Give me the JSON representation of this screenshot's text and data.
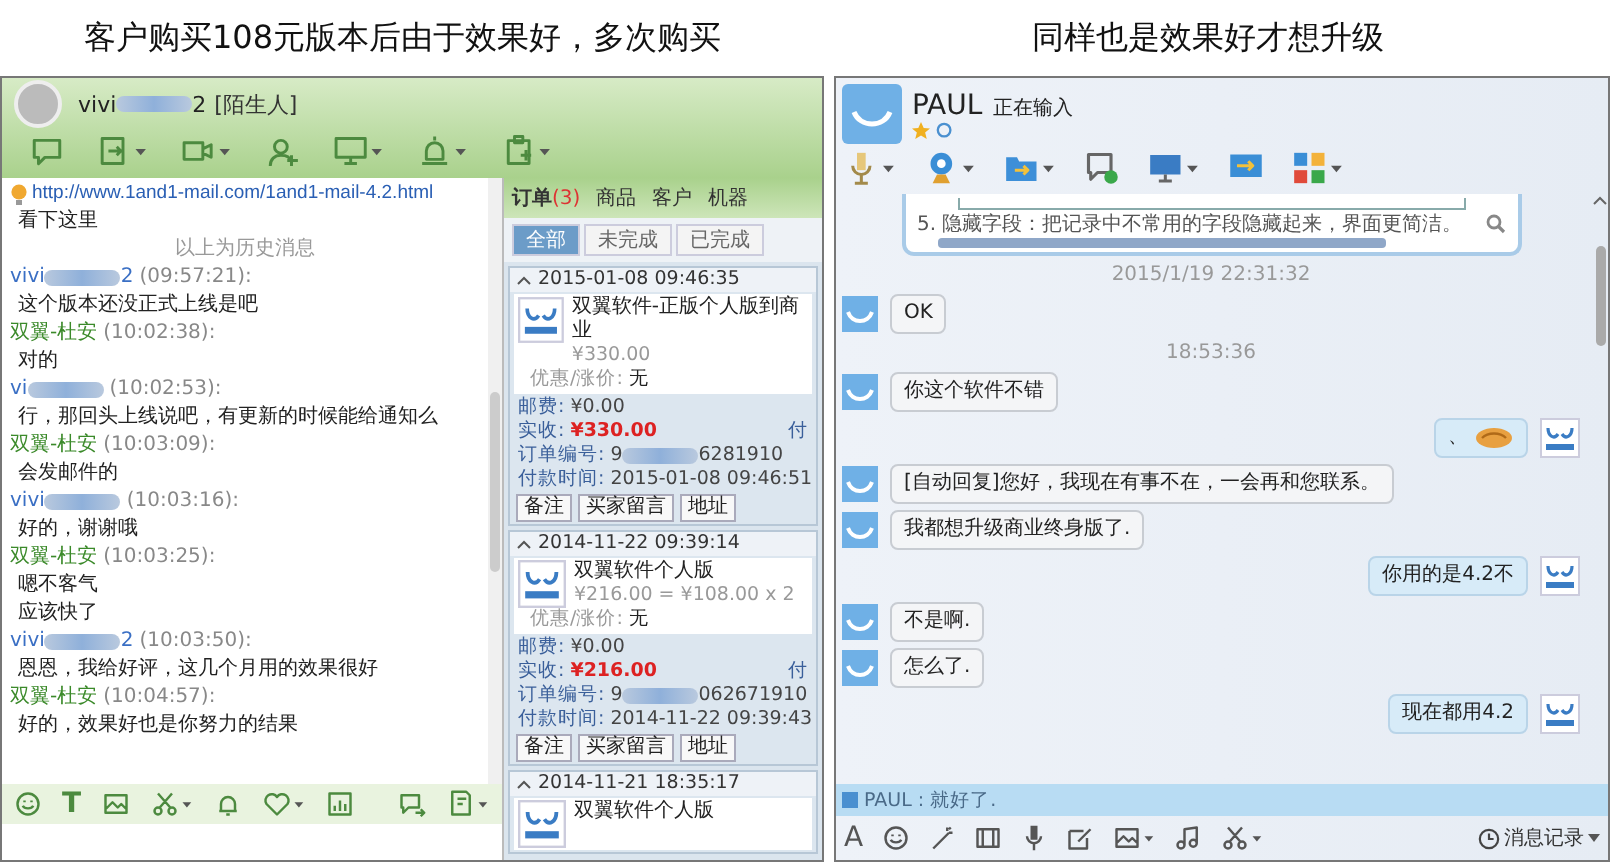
{
  "captions": [
    "客户购买108元版本后由于效果好，多次购买",
    "同样也是效果好才想升级"
  ],
  "left_window": {
    "contact": {
      "name_prefix": "vivi",
      "name_suffix": "2",
      "tag": "[陌生人]"
    },
    "link": "http://www.1and1-mail.com/1and1-mail-4.2.html",
    "link_note": "看下这里",
    "history_divider": "以上为历史消息",
    "messages": [
      {
        "kind": "customer",
        "name_prefix": "vivi",
        "name_suffix": "2",
        "time": "(09:57:21):",
        "lines": [
          "这个版本还没正式上线是吧"
        ]
      },
      {
        "kind": "agent",
        "name": "双翼-杜安",
        "time": "(10:02:38):",
        "lines": [
          "对的"
        ]
      },
      {
        "kind": "customer",
        "name_prefix": "vi",
        "time": "(10:02:53):",
        "lines": [
          "行，那回头上线说吧，有更新的时候能给通知么"
        ]
      },
      {
        "kind": "agent",
        "name": "双翼-杜安",
        "time": "(10:03:09):",
        "lines": [
          "会发邮件的"
        ]
      },
      {
        "kind": "customer",
        "name_prefix": "vivi",
        "time": "(10:03:16):",
        "lines": [
          "好的，谢谢哦"
        ]
      },
      {
        "kind": "agent",
        "name": "双翼-杜安",
        "time": "(10:03:25):",
        "lines": [
          "嗯不客气",
          "应该快了"
        ]
      },
      {
        "kind": "customer",
        "name_prefix": "vivi",
        "name_suffix": "2",
        "time": "(10:03:50):",
        "lines": [
          "恩恩，我给好评，这几个月用的效果很好"
        ]
      },
      {
        "kind": "agent",
        "name": "双翼-杜安",
        "time": "(10:04:57):",
        "lines": [
          "好的，效果好也是你努力的结果"
        ]
      }
    ],
    "font_button": "T",
    "tabs": [
      {
        "label": "订单",
        "badge": "(3)",
        "selected": true
      },
      {
        "label": "商品",
        "selected": false
      },
      {
        "label": "客户",
        "selected": false
      },
      {
        "label": "机器",
        "selected": false
      }
    ],
    "order_filters": [
      {
        "label": "全部",
        "selected": true
      },
      {
        "label": "未完成",
        "selected": false
      },
      {
        "label": "已完成",
        "selected": false
      }
    ],
    "orders": [
      {
        "expanded": true,
        "date": "2015-01-08 09:46:35",
        "product": "双翼软件-正版个人版到商业",
        "price": "¥330.00",
        "discount_label": "优惠/涨价:",
        "discount": "无",
        "fields": [
          {
            "kind": "plain",
            "label": "邮费:",
            "value": "¥0.00"
          },
          {
            "kind": "amount",
            "label": "实收:",
            "value": "¥330.00",
            "side_text": "付"
          },
          {
            "kind": "redacted",
            "label": "订单编号:",
            "value_prefix": "9",
            "value_suffix": "6281910"
          },
          {
            "kind": "plain",
            "label": "付款时间:",
            "value": "2015-01-08 09:46:51"
          }
        ],
        "buttons": [
          "备注",
          "买家留言",
          "地址"
        ]
      },
      {
        "expanded": true,
        "date": "2014-11-22 09:39:14",
        "product": "双翼软件个人版",
        "price": "¥216.00 = ¥108.00 x 2",
        "discount_label": "优惠/涨价:",
        "discount": "无",
        "fields": [
          {
            "kind": "plain",
            "label": "邮费:",
            "value": "¥0.00"
          },
          {
            "kind": "amount",
            "label": "实收:",
            "value": "¥216.00",
            "side_text": "付"
          },
          {
            "kind": "redacted",
            "label": "订单编号:",
            "value_prefix": "9",
            "value_suffix": "062671910"
          },
          {
            "kind": "plain",
            "label": "付款时间:",
            "value": "2014-11-22 09:39:43"
          }
        ],
        "buttons": [
          "备注",
          "买家留言",
          "地址"
        ]
      },
      {
        "expanded": true,
        "date": "2014-11-21 18:35:17",
        "product": "双翼软件个人版"
      }
    ]
  },
  "right_window": {
    "contact": {
      "name": "PAUL",
      "status": "正在输入"
    },
    "shared_image_text": "5. 隐藏字段：把记录中不常用的字段隐藏起来，界面更简洁。",
    "messages": [
      {
        "kind": "time",
        "text": "2015/1/19 22:31:32"
      },
      {
        "kind": "in",
        "text": "OK"
      },
      {
        "kind": "time",
        "text": "18:53:36"
      },
      {
        "kind": "in",
        "text": "你这个软件不错"
      },
      {
        "kind": "out_emoji",
        "text": "、"
      },
      {
        "kind": "in",
        "text": "[自动回复]您好，我现在有事不在，一会再和您联系。"
      },
      {
        "kind": "in",
        "text": "我都想升级商业终身版了."
      },
      {
        "kind": "out",
        "text": "你用的是4.2不"
      },
      {
        "kind": "in",
        "text": "不是啊."
      },
      {
        "kind": "in",
        "text": "怎么了."
      },
      {
        "kind": "out",
        "text": "现在都用4.2"
      }
    ],
    "quote": {
      "name": "PAUL",
      "separator": ":",
      "text": "就好了."
    },
    "font_button": "A",
    "history_button": "消息记录"
  }
}
